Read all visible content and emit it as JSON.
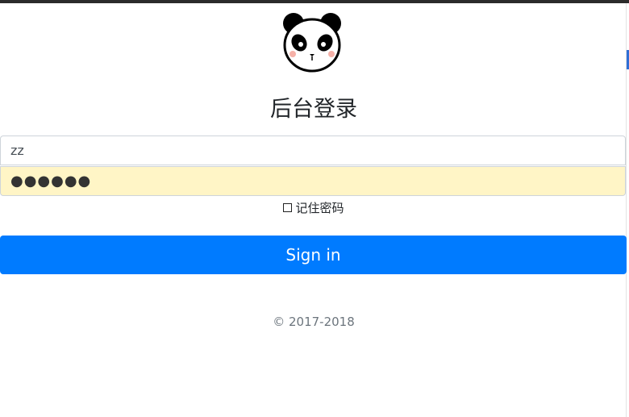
{
  "page": {
    "title": "后台登录"
  },
  "form": {
    "username_value": "zz",
    "password_value": "●●●●●●",
    "remember_label": "记住密码",
    "signin_label": "Sign in"
  },
  "footer": {
    "copyright": "© 2017-2018"
  },
  "colors": {
    "primary": "#007bff",
    "autofill": "#fff5c6"
  },
  "icons": {
    "logo": "panda-logo-icon"
  }
}
